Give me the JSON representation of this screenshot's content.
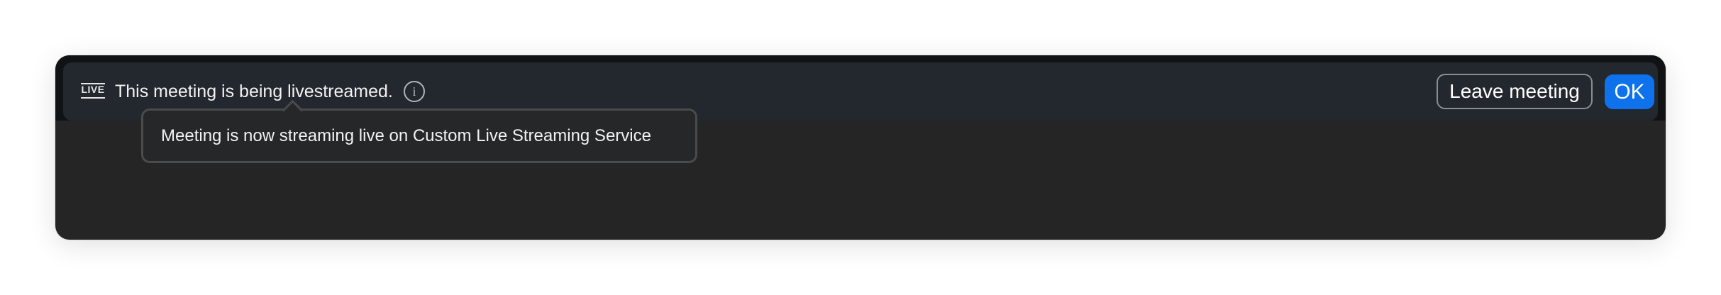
{
  "banner": {
    "live_badge": "LIVE",
    "message": "This meeting is being livestreamed.",
    "info_icon": "info-circle-icon"
  },
  "buttons": {
    "leave_label": "Leave meeting",
    "ok_label": "OK"
  },
  "tooltip": {
    "text": "Meeting is now streaming live on Custom Live Streaming Service"
  },
  "colors": {
    "window_bg": "#252525",
    "banner_bg": "#23272e",
    "accent": "#0e72ed",
    "text": "#f2f2f2"
  }
}
